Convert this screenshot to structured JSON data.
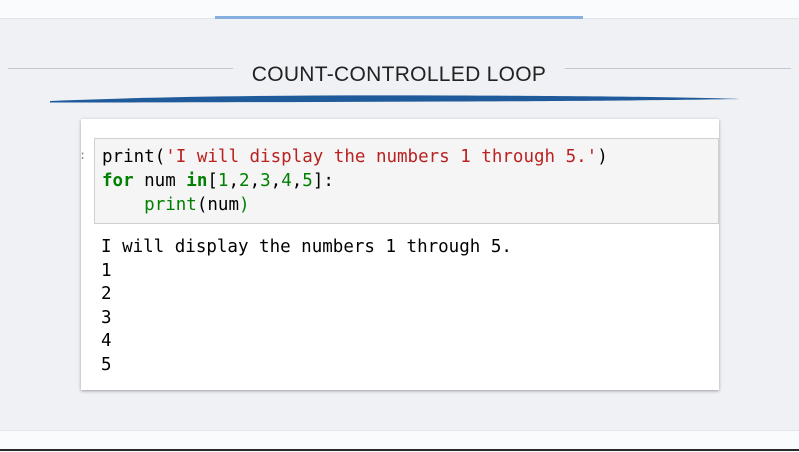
{
  "slide": {
    "title": "COUNT-CONTROLLED LOOP"
  },
  "colors": {
    "background": "#f0f1f5",
    "top_accent": "#86aee0",
    "swoosh": "#1f5a9a",
    "code_cell_bg": "#f5f5f5",
    "string": "#ba2121",
    "keyword": "#008000"
  },
  "notebook": {
    "prompt": ":",
    "code": {
      "line1": {
        "fn": "print",
        "open": "(",
        "str": "'I will display the numbers 1 through 5.'",
        "close": ")"
      },
      "line2": {
        "kw_for": "for",
        "var": " num ",
        "kw_in": "in",
        "list_open": "[",
        "n1": "1",
        "c1": ",",
        "n2": "2",
        "c2": ",",
        "n3": "3",
        "c3": ",",
        "n4": "4",
        "c4": ",",
        "n5": "5",
        "list_close": "]:"
      },
      "line3": {
        "indent": "    ",
        "fn": "print",
        "open": "(",
        "arg": "num",
        "close": ")"
      }
    },
    "output": [
      "I will display the numbers 1 through 5.",
      "1",
      "2",
      "3",
      "4",
      "5"
    ]
  }
}
